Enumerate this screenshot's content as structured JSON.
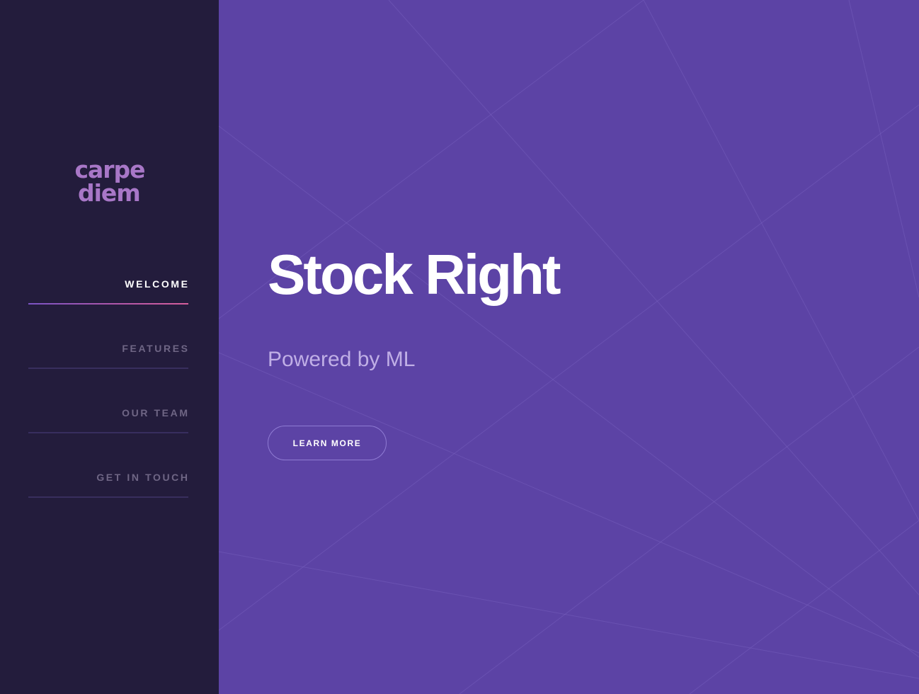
{
  "colors": {
    "sidebar_bg": "#231c3c",
    "main_bg": "#5c43a5",
    "logo": "#a877c7",
    "nav_inactive": "#6f6685",
    "nav_active": "#ffffff",
    "accent_gradient_start": "#7b54c4",
    "accent_gradient_end": "#d65e9c"
  },
  "sidebar": {
    "logo": {
      "line1": "carpe",
      "line2": "diem"
    },
    "nav": [
      {
        "label": "WELCOME",
        "active": true
      },
      {
        "label": "FEATURES",
        "active": false
      },
      {
        "label": "OUR TEAM",
        "active": false
      },
      {
        "label": "GET IN TOUCH",
        "active": false
      }
    ]
  },
  "hero": {
    "title": "Stock Right",
    "subtitle": "Powered by ML",
    "cta_label": "LEARN MORE"
  }
}
